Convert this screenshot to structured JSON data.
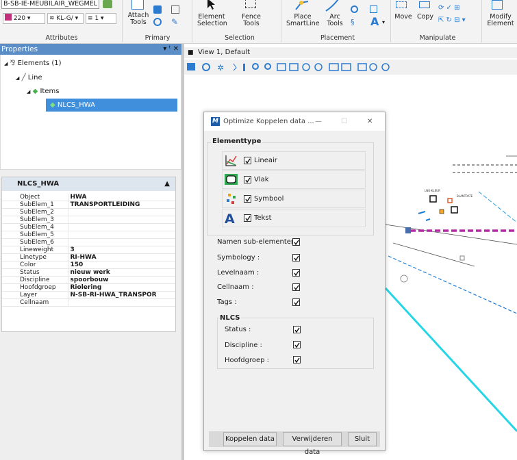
{
  "ribbon": {
    "level_combo": "B-SB-IE-MEUBILAIR_WEGMEL",
    "color_value": "220",
    "style_value": "KL-G/",
    "weight_value": "1",
    "attach_tools_label": "Attach Tools",
    "element_selection_label": "Element Selection",
    "fence_tools_label": "Fence Tools",
    "place_smartline_label": "Place SmartLine",
    "arc_tools_label": "Arc Tools",
    "text_tool_label": "A",
    "move_label": "Move",
    "copy_label": "Copy",
    "modify_element_label": "Modify Element",
    "groups": [
      "Attributes",
      "Primary",
      "Selection",
      "Placement",
      "Manipulate"
    ]
  },
  "properties": {
    "title": "Properties",
    "pin_label": "▾ ᵗ ✕",
    "tree": {
      "elements": "Elements (1)",
      "line": "Line",
      "items": "Items",
      "selected": "NLCS_HWA"
    },
    "panel_title": "NLCS_HWA",
    "rows": [
      {
        "key": "Object",
        "value": "HWA"
      },
      {
        "key": "SubElem_1",
        "value": "TRANSPORTLEIDING"
      },
      {
        "key": "SubElem_2",
        "value": ""
      },
      {
        "key": "SubElem_3",
        "value": ""
      },
      {
        "key": "SubElem_4",
        "value": ""
      },
      {
        "key": "SubElem_5",
        "value": ""
      },
      {
        "key": "SubElem_6",
        "value": ""
      },
      {
        "key": "Lineweight",
        "value": "3"
      },
      {
        "key": "Linetype",
        "value": "RI-HWA"
      },
      {
        "key": "Color",
        "value": "150"
      },
      {
        "key": "Status",
        "value": "nieuw werk"
      },
      {
        "key": "Discipline",
        "value": "spoorbouw"
      },
      {
        "key": "Hoofdgroep",
        "value": "Riolering"
      },
      {
        "key": "Layer",
        "value": "N-SB-RI-HWA_TRANSPOR"
      },
      {
        "key": "Cellnaam",
        "value": ""
      }
    ]
  },
  "view": {
    "title": "View 1, Default"
  },
  "dialog": {
    "title": "Optimize Koppelen data ...",
    "minimize": "—",
    "maximize": "☐",
    "close": "✕",
    "elementtype_heading": "Elementtype",
    "elementtypes": [
      {
        "label": "Lineair",
        "checked": true,
        "icon": "linear-icon"
      },
      {
        "label": "Vlak",
        "checked": true,
        "icon": "shape-icon"
      },
      {
        "label": "Symbool",
        "checked": true,
        "icon": "symbol-icon"
      },
      {
        "label": "Tekst",
        "checked": true,
        "icon": "text-icon"
      }
    ],
    "options": [
      {
        "label": "Namen sub-elementen",
        "checked": true
      },
      {
        "label": "Symbology :",
        "checked": true
      },
      {
        "label": "Levelnaam :",
        "checked": true
      },
      {
        "label": "Cellnaam :",
        "checked": true
      },
      {
        "label": "Tags :",
        "checked": true
      }
    ],
    "nlcs_heading": "NLCS",
    "nlcs_options": [
      {
        "label": "Status :",
        "checked": true
      },
      {
        "label": "Discipline :",
        "checked": true
      },
      {
        "label": "Hoofdgroep :",
        "checked": true
      }
    ],
    "buttons": {
      "couple": "Koppelen data",
      "remove": "Verwijderen data",
      "close": "Sluit"
    }
  },
  "canvas": {
    "small_label_1": "LNG-KLEUR",
    "small_label_2": "BLANTRATE"
  },
  "colors": {
    "accent_blue": "#5b8dc6",
    "selection_blue": "#3f8fdc",
    "cyan_line": "#25d6e6",
    "magenta_line": "#b32aa3"
  }
}
